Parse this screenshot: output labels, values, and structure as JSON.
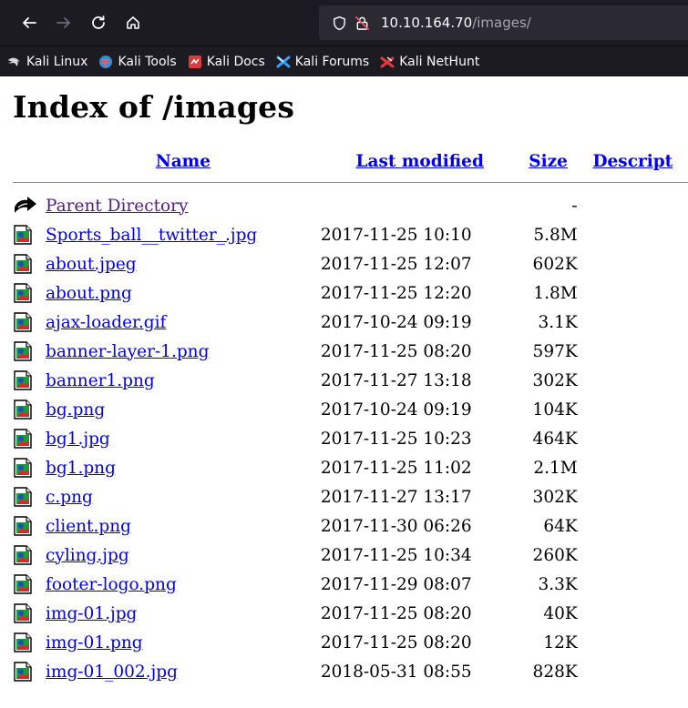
{
  "browser": {
    "url_host": "10.10.164.70",
    "url_path": "/images/",
    "bookmarks": [
      {
        "label": "Kali Linux",
        "icon": "kali-dragon-icon"
      },
      {
        "label": "Kali Tools",
        "icon": "kali-tools-icon"
      },
      {
        "label": "Kali Docs",
        "icon": "kali-docs-icon"
      },
      {
        "label": "Kali Forums",
        "icon": "kali-forums-icon"
      },
      {
        "label": "Kali NetHunt",
        "icon": "kali-nethunter-icon"
      }
    ]
  },
  "page": {
    "title": "Index of /images",
    "columns": {
      "name": "Name",
      "last_modified": "Last modified",
      "size": "Size",
      "description": "Descript"
    },
    "parent": {
      "label": "Parent Directory",
      "size": "-"
    },
    "files": [
      {
        "name": "Sports_ball__twitter_.jpg",
        "date": "2017-11-25 10:10",
        "size": "5.8M"
      },
      {
        "name": "about.jpeg",
        "date": "2017-11-25 12:07",
        "size": "602K"
      },
      {
        "name": "about.png",
        "date": "2017-11-25 12:20",
        "size": "1.8M"
      },
      {
        "name": "ajax-loader.gif",
        "date": "2017-10-24 09:19",
        "size": "3.1K"
      },
      {
        "name": "banner-layer-1.png",
        "date": "2017-11-25 08:20",
        "size": "597K"
      },
      {
        "name": "banner1.png",
        "date": "2017-11-27 13:18",
        "size": "302K"
      },
      {
        "name": "bg.png",
        "date": "2017-10-24 09:19",
        "size": "104K"
      },
      {
        "name": "bg1.jpg",
        "date": "2017-11-25 10:23",
        "size": "464K"
      },
      {
        "name": "bg1.png",
        "date": "2017-11-25 11:02",
        "size": "2.1M"
      },
      {
        "name": "c.png",
        "date": "2017-11-27 13:17",
        "size": "302K"
      },
      {
        "name": "client.png",
        "date": "2017-11-30 06:26",
        "size": "64K"
      },
      {
        "name": "cyling.jpg",
        "date": "2017-11-25 10:34",
        "size": "260K"
      },
      {
        "name": "footer-logo.png",
        "date": "2017-11-29 08:07",
        "size": "3.3K"
      },
      {
        "name": "img-01.jpg",
        "date": "2017-11-25 08:20",
        "size": "40K"
      },
      {
        "name": "img-01.png",
        "date": "2017-11-25 08:20",
        "size": "12K"
      },
      {
        "name": "img-01_002.jpg",
        "date": "2018-05-31 08:55",
        "size": "828K"
      }
    ]
  },
  "colors": {
    "link": "#0000ee",
    "visited": "#551a8b",
    "chrome_bg": "#1c1b22",
    "urlbar_bg": "#2b2a33"
  }
}
